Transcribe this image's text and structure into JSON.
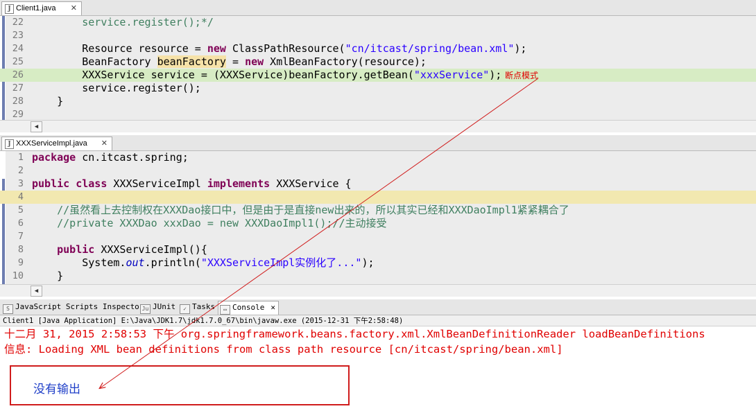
{
  "editor1": {
    "tab_label": "Client1.java",
    "lines": [
      {
        "num": "22",
        "segs": [
          {
            "t": "        "
          },
          {
            "t": "service.register();*/",
            "c": "cm"
          }
        ]
      },
      {
        "num": "23",
        "segs": [
          {
            "t": ""
          }
        ]
      },
      {
        "num": "24",
        "segs": [
          {
            "t": "        Resource resource = "
          },
          {
            "t": "new",
            "c": "kw"
          },
          {
            "t": " ClassPathResource("
          },
          {
            "t": "\"cn/itcast/spring/bean.xml\"",
            "c": "str"
          },
          {
            "t": ");"
          }
        ]
      },
      {
        "num": "25",
        "segs": [
          {
            "t": "        BeanFactory "
          },
          {
            "t": "beanFactory",
            "c": "hlvar"
          },
          {
            "t": " = "
          },
          {
            "t": "new",
            "c": "kw"
          },
          {
            "t": " XmlBeanFactory(resource);"
          }
        ]
      },
      {
        "num": "26",
        "segs": [
          {
            "t": "        XXXService service = (XXXService)beanFactory.getBean("
          },
          {
            "t": "\"xxxService\"",
            "c": "str"
          },
          {
            "t": ");"
          }
        ],
        "highlight": "green"
      },
      {
        "num": "27",
        "segs": [
          {
            "t": "        service.register();"
          }
        ]
      },
      {
        "num": "28",
        "segs": [
          {
            "t": "    }"
          }
        ]
      },
      {
        "num": "29",
        "segs": [
          {
            "t": ""
          }
        ]
      }
    ]
  },
  "editor2": {
    "tab_label": "XXXServiceImpl.java",
    "lines": [
      {
        "num": "1",
        "segs": [
          {
            "t": "package",
            "c": "kw"
          },
          {
            "t": " cn.itcast.spring;"
          }
        ]
      },
      {
        "num": "2",
        "segs": [
          {
            "t": ""
          }
        ]
      },
      {
        "num": "3",
        "segs": [
          {
            "t": "public",
            "c": "kw"
          },
          {
            "t": " "
          },
          {
            "t": "class",
            "c": "kw"
          },
          {
            "t": " XXXServiceImpl "
          },
          {
            "t": "implements",
            "c": "kw"
          },
          {
            "t": " XXXService {"
          }
        ]
      },
      {
        "num": "4",
        "segs": [
          {
            "t": ""
          }
        ],
        "highlight": "yellow"
      },
      {
        "num": "5",
        "segs": [
          {
            "t": "    "
          },
          {
            "t": "//虽然看上去控制权在XXXDao接口中，但是由于是直接new出来的，所以其实已经和XXXDaoImpl1紧紧耦合了",
            "c": "cm"
          }
        ]
      },
      {
        "num": "6",
        "segs": [
          {
            "t": "    "
          },
          {
            "t": "//private XXXDao xxxDao = new XXXDaoImpl1();//主动接受",
            "c": "cm"
          }
        ]
      },
      {
        "num": "7",
        "segs": [
          {
            "t": ""
          }
        ]
      },
      {
        "num": "8",
        "segs": [
          {
            "t": "    "
          },
          {
            "t": "public",
            "c": "kw"
          },
          {
            "t": " XXXServiceImpl(){"
          }
        ]
      },
      {
        "num": "9",
        "segs": [
          {
            "t": "        System."
          },
          {
            "t": "out",
            "c": "fld"
          },
          {
            "t": ".println("
          },
          {
            "t": "\"XXXServiceImpl实例化了...\"",
            "c": "str"
          },
          {
            "t": ");"
          }
        ]
      },
      {
        "num": "10",
        "segs": [
          {
            "t": "    }"
          }
        ]
      }
    ]
  },
  "views": {
    "tabs": [
      {
        "label": "JavaScript Scripts Inspector",
        "icon": "script-inspector-icon"
      },
      {
        "label": "JUnit",
        "icon": "junit-icon"
      },
      {
        "label": "Tasks",
        "icon": "tasks-icon"
      },
      {
        "label": "Console",
        "icon": "console-icon",
        "active": true
      }
    ]
  },
  "console": {
    "header": "Client1 [Java Application] E:\\Java\\JDK1.7\\jdk1.7.0_67\\bin\\javaw.exe (2015-12-31 下午2:58:48)",
    "line1": "十二月 31, 2015 2:58:53 下午 org.springframework.beans.factory.xml.XmlBeanDefinitionReader loadBeanDefinitions",
    "line2": "信息: Loading XML bean definitions from class path resource [cn/itcast/spring/bean.xml]"
  },
  "annotations": {
    "breakpoint_label": "断点模式",
    "no_output_label": "没有输出"
  },
  "colors": {
    "keyword": "#7f0055",
    "string": "#2a00ff",
    "comment": "#3f7f5f",
    "console_error": "#e00000",
    "annotation_red": "#d01c1c"
  }
}
